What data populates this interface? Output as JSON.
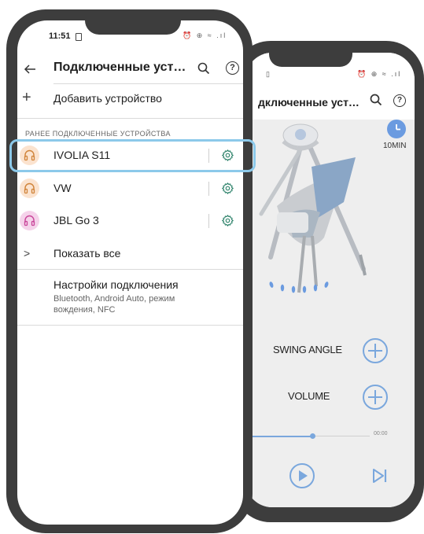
{
  "back_phone": {
    "status_icons": "⏰ ⊕ ≈ .ıl",
    "title": "дключенные уст…",
    "timer_label": "10MIN",
    "swing_angle_label": "SWING ANGLE",
    "volume_label": "VOLUME",
    "track_time": "00:00",
    "progress": 0.53
  },
  "front_phone": {
    "status": {
      "time": "11:51",
      "icons": "⏰ ⊕ ≈ .ıl"
    },
    "header": {
      "title": "Подключенные уст…"
    },
    "add_device_label": "Добавить устройство",
    "section_label": "РАНЕЕ ПОДКЛЮЧЕННЫЕ УСТРОЙСТВА",
    "devices": [
      {
        "name": "IVOLIA S11",
        "avatar_bg": "#fbe3cf",
        "icon_color": "#d0843a"
      },
      {
        "name": "VW",
        "avatar_bg": "#fbe3cf",
        "icon_color": "#d0843a"
      },
      {
        "name": "JBL Go 3",
        "avatar_bg": "#f5d2ea",
        "icon_color": "#c9469a"
      }
    ],
    "show_all_label": "Показать все",
    "connection_settings": {
      "title": "Настройки подключения",
      "subtitle": "Bluetooth, Android Auto, режим вождения, NFC"
    }
  },
  "colors": {
    "highlight": "#8cc9ea",
    "accent_green": "#1f7a60",
    "app_blue": "#7aa7dd"
  }
}
